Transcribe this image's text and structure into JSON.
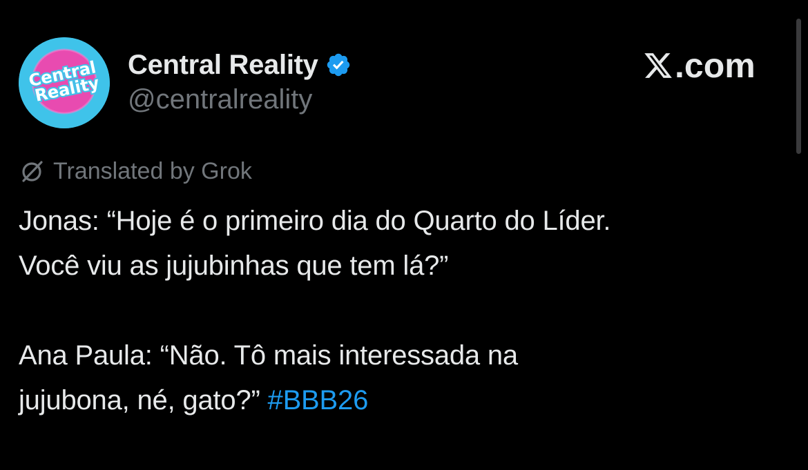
{
  "account": {
    "display_name": "Central Reality",
    "handle": "@centralreality",
    "avatar_text_line1": "Central",
    "avatar_text_line2": "Reality",
    "verified_color": "#1d9bf0",
    "avatar_color": "#3fc3ea",
    "avatar_accent_color": "#e84bb0"
  },
  "brand": {
    "suffix": ".com"
  },
  "translation": {
    "label": "Translated by Grok"
  },
  "tweet": {
    "paragraph1": "Jonas: “Hoje é o primeiro dia do Quarto do Líder.\nVocê viu as jujubinhas que tem lá?”",
    "paragraph2": "Ana Paula: “Não. Tô mais interessada na\njujubona, né, gato?” ",
    "hashtag": "#BBB26",
    "hashtag_color": "#1d9bf0"
  }
}
